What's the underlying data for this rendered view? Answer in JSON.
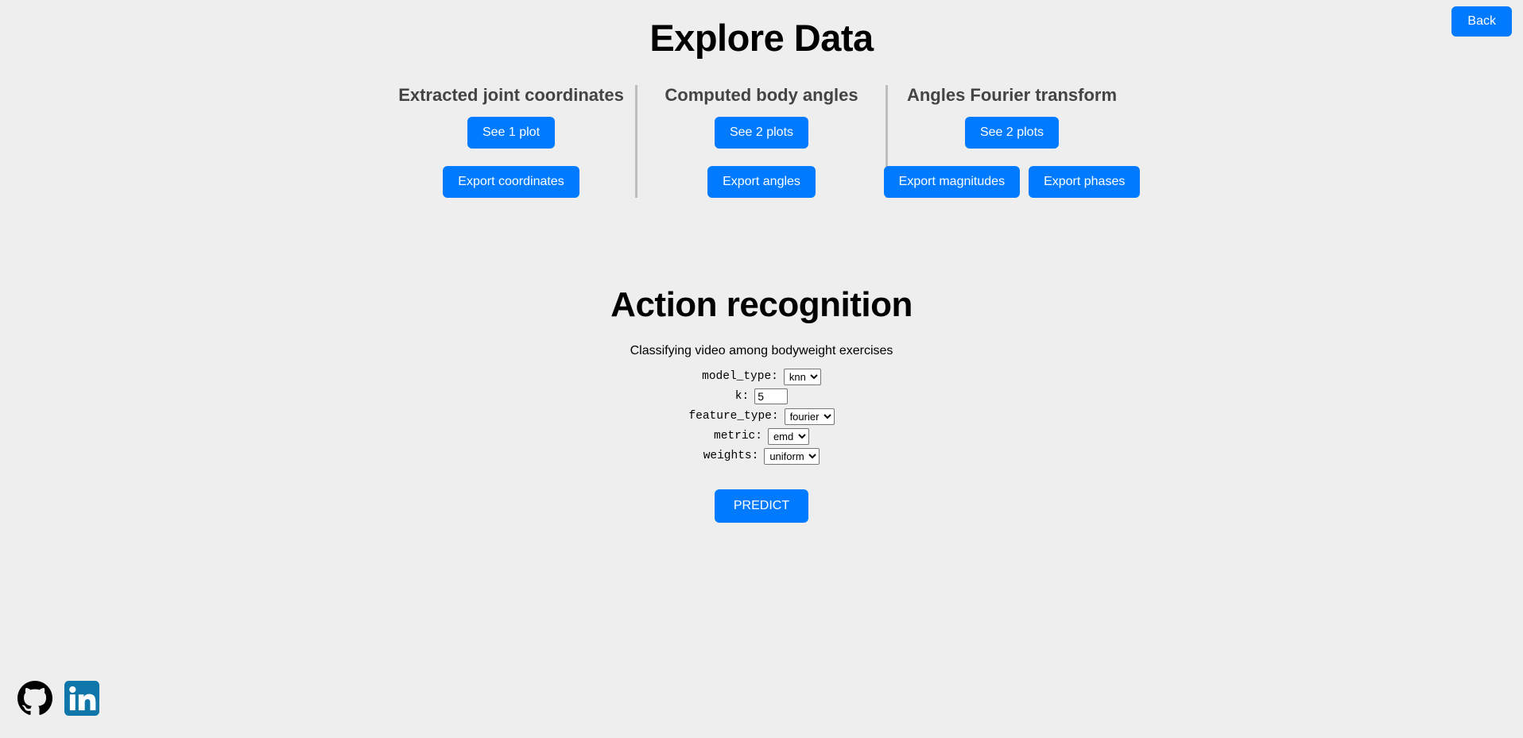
{
  "header": {
    "title": "Explore Data",
    "back_label": "Back"
  },
  "explore": {
    "columns": [
      {
        "title": "Extracted joint coordinates",
        "plot_button": "See 1 plot",
        "export_buttons": [
          "Export coordinates"
        ]
      },
      {
        "title": "Computed body angles",
        "plot_button": "See 2 plots",
        "export_buttons": [
          "Export angles"
        ]
      },
      {
        "title": "Angles Fourier transform",
        "plot_button": "See 2 plots",
        "export_buttons": [
          "Export magnitudes",
          "Export phases"
        ]
      }
    ]
  },
  "action": {
    "title": "Action recognition",
    "subtitle": "Classifying video among bodyweight exercises",
    "fields": [
      {
        "label": "model_type:",
        "control": "select",
        "value": "knn",
        "options": [
          "knn"
        ]
      },
      {
        "label": "k:",
        "control": "text",
        "value": "5",
        "placeholder": ""
      },
      {
        "label": "feature_type:",
        "control": "select",
        "value": "fourier",
        "options": [
          "fourier"
        ]
      },
      {
        "label": "metric:",
        "control": "select",
        "value": "emd",
        "options": [
          "emd"
        ]
      },
      {
        "label": "weights:",
        "control": "select",
        "value": "uniform",
        "options": [
          "uniform"
        ]
      }
    ],
    "predict_label": "PREDICT"
  },
  "footer": {
    "social": [
      {
        "name": "github-icon",
        "color": "#000000"
      },
      {
        "name": "linkedin-icon",
        "color": "#0e76a8"
      }
    ]
  },
  "colors": {
    "accent": "#007bff",
    "background": "#eeeeee",
    "heading": "#444444",
    "divider": "#bdbdbd"
  }
}
